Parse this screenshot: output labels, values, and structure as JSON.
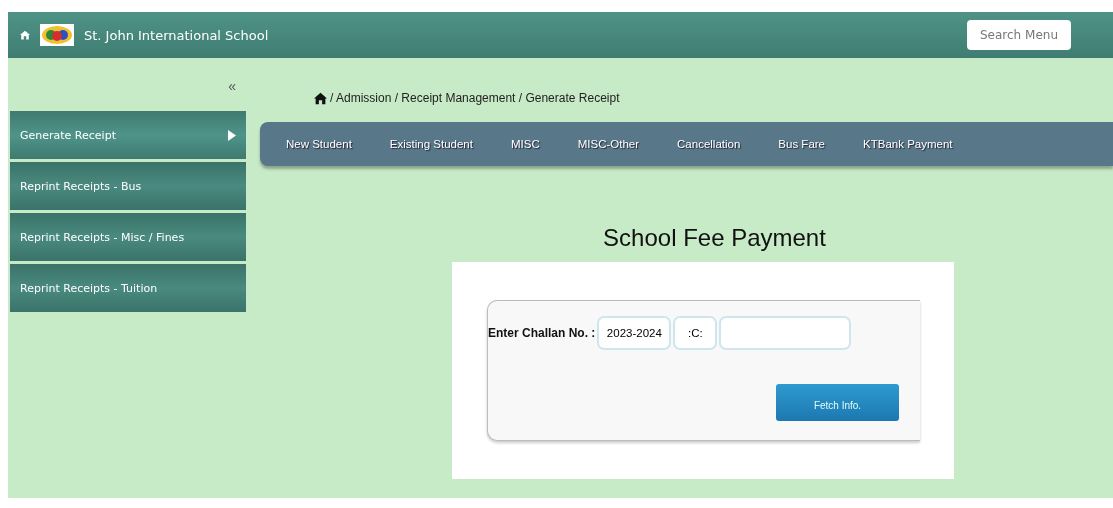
{
  "header": {
    "school_name": "St. John International School",
    "search": {
      "placeholder": "Search Menu"
    }
  },
  "sidebar": {
    "collapse": "«",
    "items": [
      {
        "label": "Generate Receipt",
        "selected": true
      },
      {
        "label": "Reprint Receipts - Bus",
        "selected": false
      },
      {
        "label": "Reprint Receipts - Misc / Fines",
        "selected": false
      },
      {
        "label": "Reprint Receipts - Tuition",
        "selected": false
      }
    ]
  },
  "breadcrumb": "/ Admission / Receipt Management / Generate Receipt",
  "nav": [
    "New Student",
    "Existing Student",
    "MISC",
    "MISC-Other",
    "Cancellation",
    "Bus Fare",
    "KTBank Payment"
  ],
  "title": "School Fee Payment",
  "form": {
    "label": "Enter Challan No. :",
    "year": "2023-2024",
    "code": ":C:",
    "button": "Fetch Info."
  }
}
